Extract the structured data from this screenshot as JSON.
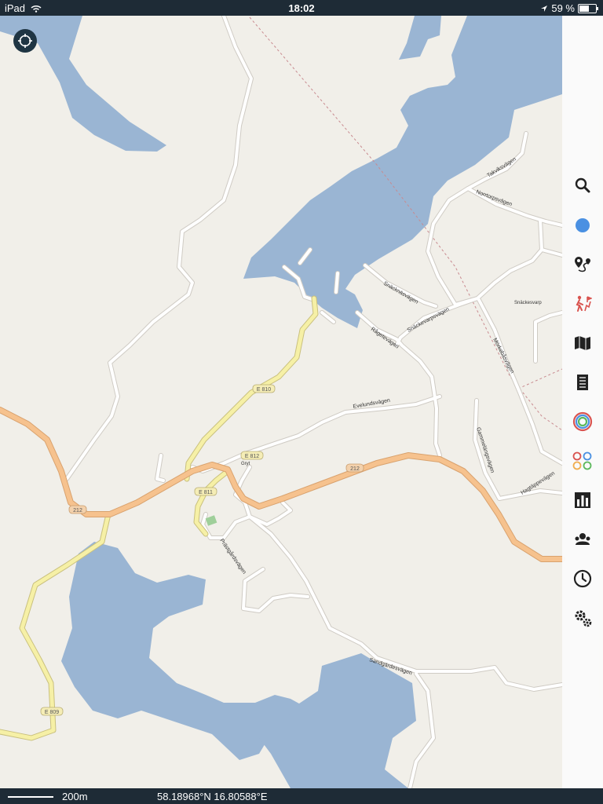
{
  "status_bar": {
    "device": "iPad",
    "time": "18:02",
    "battery_text": "59 %",
    "battery_level": 0.59
  },
  "map": {
    "roads": {
      "takviksvagen": "Takviksvägen",
      "norrtorpsvagen": "Norrtorpsvägen",
      "snacknasvagen": "Snäcknäsvägen",
      "snackevarpsvagen": "Snäckevarpsvägen",
      "ragetevagen": "Rågetevägen",
      "morkebasvagen": "Mörkebåsvägen",
      "evelundsvagen": "Evelundsvägen",
      "gammelangsvagen": "Gammelängsvägen",
      "hagtappevagen": "Hagtäppevägen",
      "prastgardsvagen": "Prästgårdsvägen",
      "sandgardesvagen": "Sandgärdesvägen"
    },
    "places": {
      "snackesvarp": "Snäckesvarp",
      "gryt": "Gryt"
    },
    "shields": {
      "e810": "E 810",
      "e812": "E 812",
      "e811": "E 811",
      "e809": "E 809",
      "r212a": "212",
      "r212b": "212"
    },
    "colors": {
      "land": "#f1efe9",
      "water": "#9ab5d3",
      "road": "#ffffff",
      "primary": "#f6c28e",
      "secondary": "#f6f0a6"
    }
  },
  "sidebar": {
    "items": [
      {
        "name": "search",
        "icon": "search-icon"
      },
      {
        "name": "location",
        "icon": "location-dot-icon"
      },
      {
        "name": "route",
        "icon": "route-icon"
      },
      {
        "name": "hiking",
        "icon": "hiking-icon"
      },
      {
        "name": "map-layers",
        "icon": "map-icon"
      },
      {
        "name": "notes",
        "icon": "list-icon"
      },
      {
        "name": "tracks",
        "icon": "rings-icon"
      },
      {
        "name": "overlays",
        "icon": "circles-icon"
      },
      {
        "name": "statistics",
        "icon": "bar-chart-icon"
      },
      {
        "name": "friends",
        "icon": "people-icon"
      },
      {
        "name": "history",
        "icon": "clock-icon"
      },
      {
        "name": "settings",
        "icon": "gears-icon"
      }
    ]
  },
  "bottom_bar": {
    "scale": "200m",
    "coordinates": "58.18968°N 16.80588°E"
  }
}
